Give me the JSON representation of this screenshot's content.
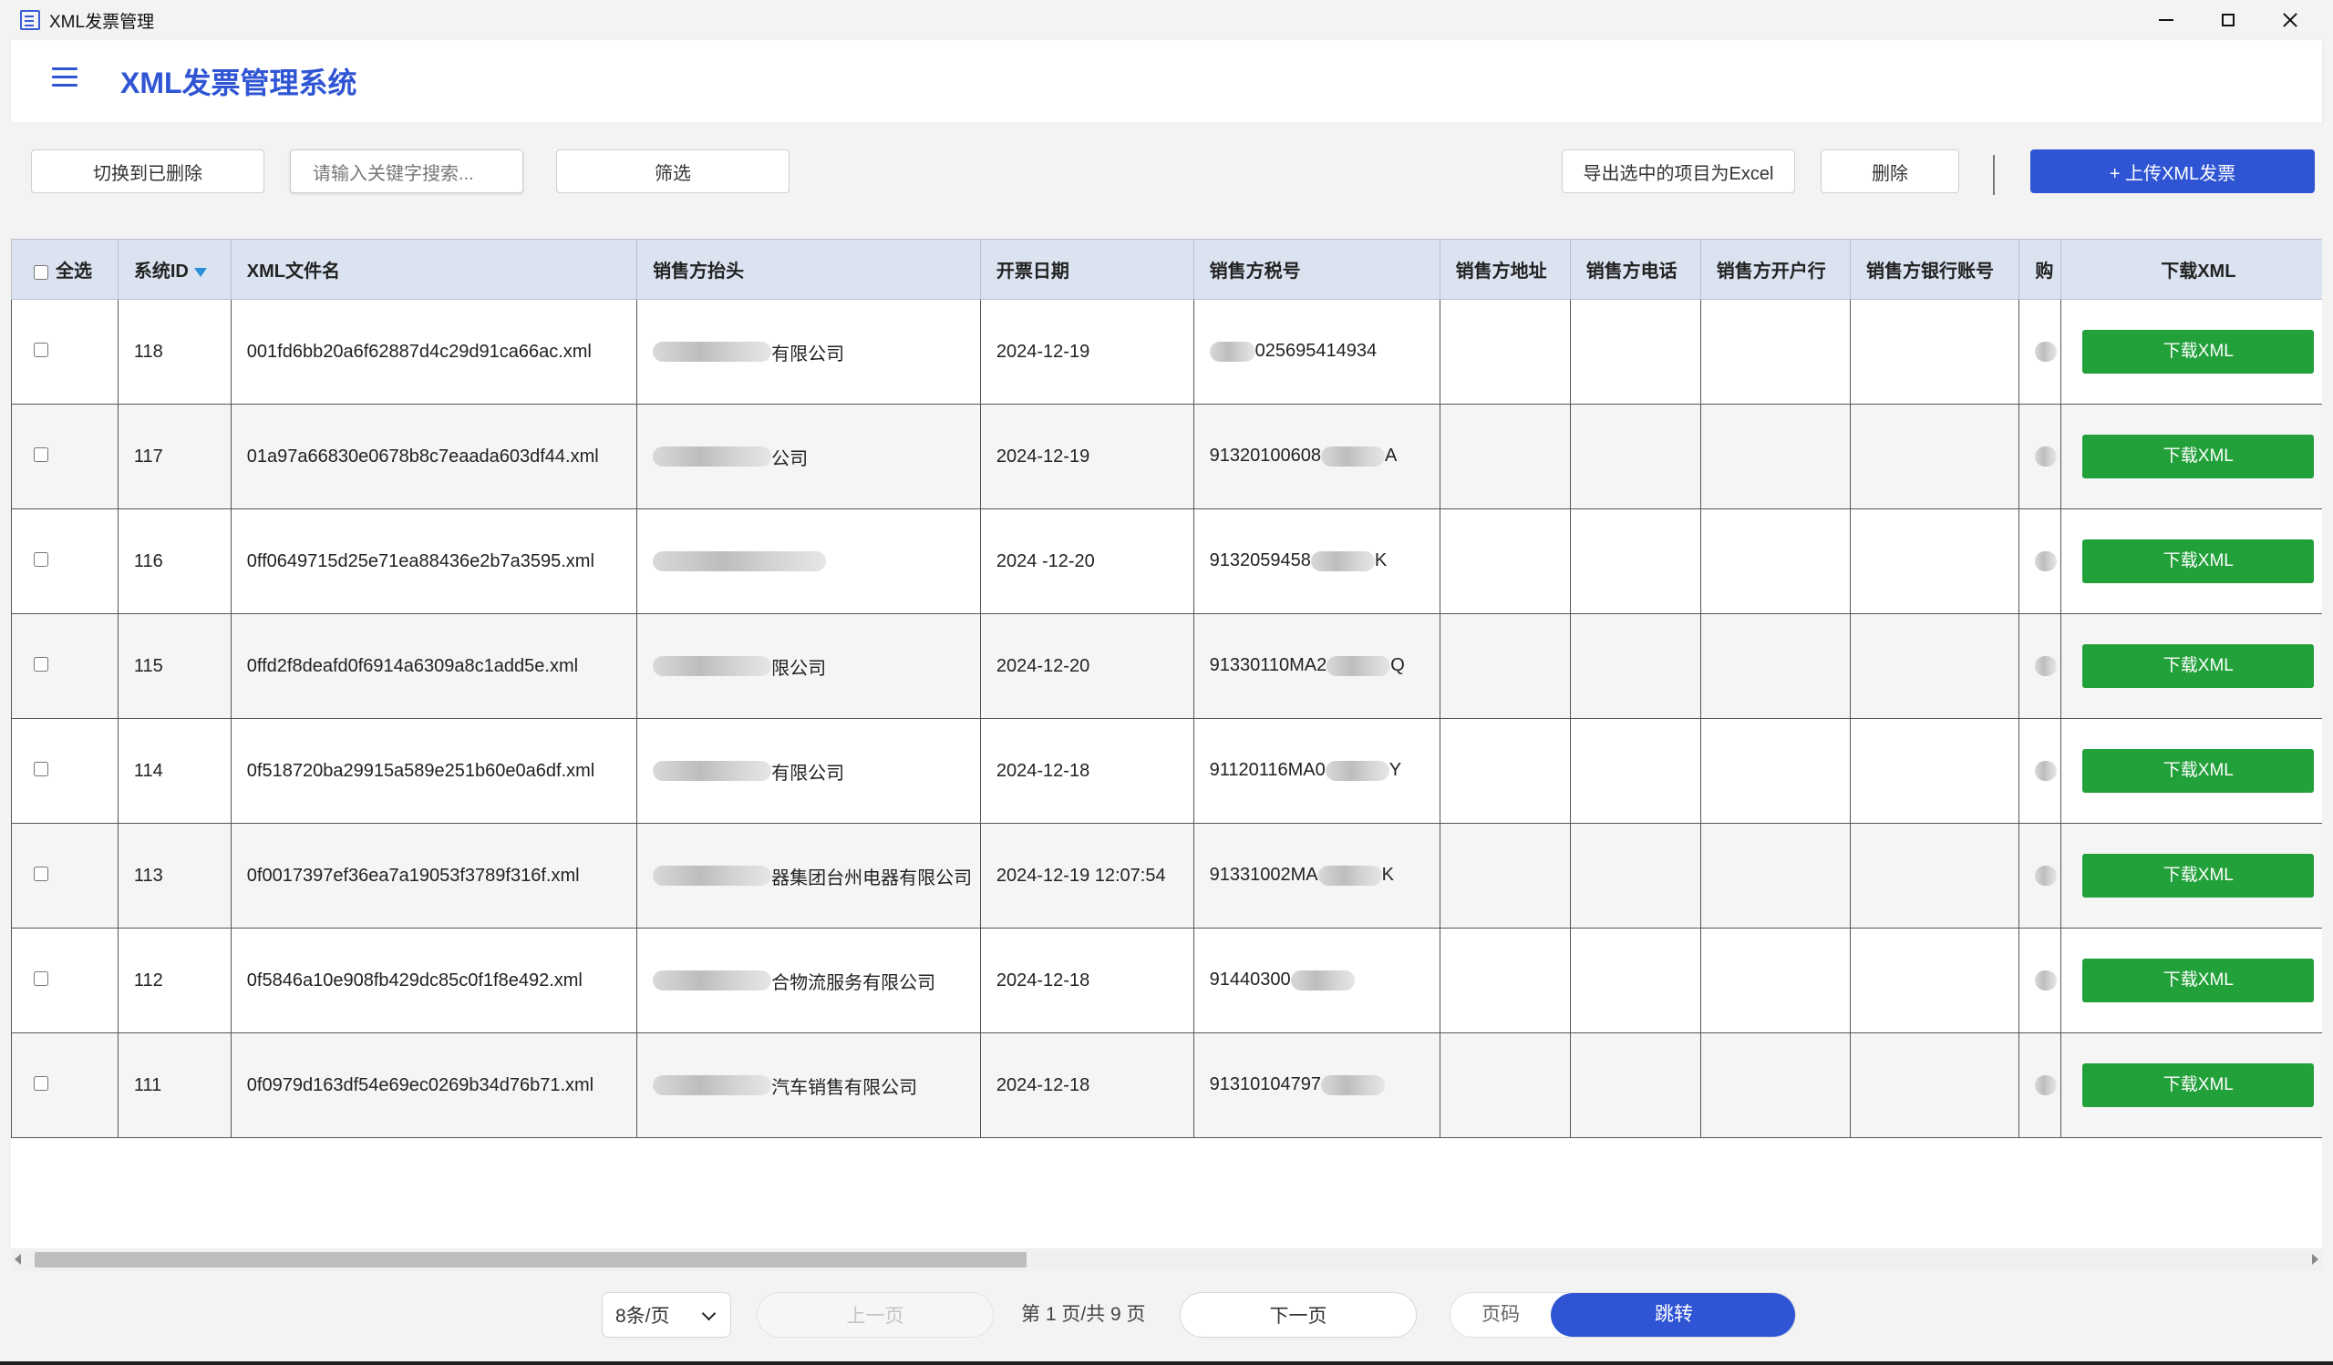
{
  "window": {
    "title": "XML发票管理"
  },
  "header": {
    "title": "XML发票管理系统"
  },
  "toolbar": {
    "switch_deleted": "切换到已删除",
    "search_placeholder": "请输入关键字搜索...",
    "filter": "筛选",
    "export_excel": "导出选中的项目为Excel",
    "delete": "删除",
    "upload": "+ 上传XML发票"
  },
  "table": {
    "columns": {
      "select_all": "全选",
      "system_id": "系统ID",
      "file_name": "XML文件名",
      "seller_name": "销售方抬头",
      "invoice_date": "开票日期",
      "seller_tax_id": "销售方税号",
      "seller_address": "销售方地址",
      "seller_phone": "销售方电话",
      "seller_bank": "销售方开户行",
      "seller_bank_account": "销售方银行账号",
      "buyer": "购",
      "download": "下载XML"
    },
    "download_label": "下载XML",
    "rows": [
      {
        "id": "118",
        "file": "001fd6bb20a6f62887d4c29d91ca66ac.xml",
        "seller_suffix": "有限公司",
        "date": "2024-12-19",
        "tax_prefix": "",
        "tax_suffix": "025695414934"
      },
      {
        "id": "117",
        "file": "01a97a66830e0678b8c7eaada603df44.xml",
        "seller_suffix": "公司",
        "date": "2024-12-19",
        "tax_prefix": "91320100608",
        "tax_suffix": "A"
      },
      {
        "id": "116",
        "file": "0ff0649715d25e71ea88436e2b7a3595.xml",
        "seller_suffix": "",
        "date": "2024 -12-20",
        "tax_prefix": "9132059458",
        "tax_suffix": "K"
      },
      {
        "id": "115",
        "file": "0ffd2f8deafd0f6914a6309a8c1add5e.xml",
        "seller_suffix": "限公司",
        "date": "2024-12-20",
        "tax_prefix": "91330110MA2",
        "tax_suffix": "Q"
      },
      {
        "id": "114",
        "file": "0f518720ba29915a589e251b60e0a6df.xml",
        "seller_suffix": "有限公司",
        "date": "2024-12-18",
        "tax_prefix": "91120116MA0",
        "tax_suffix": "Y"
      },
      {
        "id": "113",
        "file": "0f0017397ef36ea7a19053f3789f316f.xml",
        "seller_suffix": "器集团台州电器有限公司",
        "date": "2024-12-19 12:07:54",
        "tax_prefix": "91331002MA",
        "tax_suffix": "K"
      },
      {
        "id": "112",
        "file": "0f5846a10e908fb429dc85c0f1f8e492.xml",
        "seller_suffix": "合物流服务有限公司",
        "date": "2024-12-18",
        "tax_prefix": "91440300",
        "tax_suffix": ""
      },
      {
        "id": "111",
        "file": "0f0979d163df54e69ec0269b34d76b71.xml",
        "seller_suffix": "汽车销售有限公司",
        "date": "2024-12-18",
        "tax_prefix": "91310104797",
        "tax_suffix": ""
      }
    ]
  },
  "pager": {
    "page_size": "8条/页",
    "prev": "上一页",
    "page_info": "第 1 页/共 9 页",
    "next": "下一页",
    "page_input_placeholder": "页码",
    "jump": "跳转"
  },
  "colors": {
    "accent": "#2f55d4",
    "download_green": "#22a03a",
    "header_row": "#dbe3f1"
  }
}
